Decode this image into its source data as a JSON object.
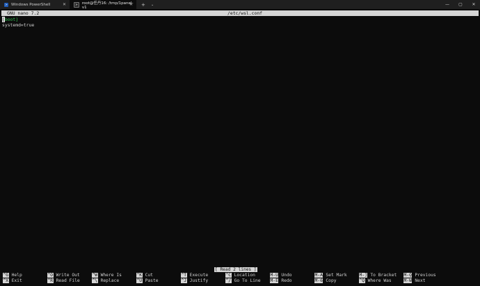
{
  "tabs": [
    {
      "label": "Windows PowerShell",
      "active": false
    },
    {
      "label": "root@任丹16: /tmp/1panel-v1",
      "active": true
    }
  ],
  "tab_actions": {
    "new_tab": "+",
    "dropdown": "⌄"
  },
  "window_controls": {
    "minimize": "—",
    "maximize": "▢",
    "close": "✕"
  },
  "nano": {
    "title_left": "GNU nano 7.2",
    "filename": "/etc/wsl.conf",
    "lines": [
      "[boot]",
      "systemd=true"
    ],
    "status": "[ Read 2 lines ]"
  },
  "shortcuts_row1": [
    {
      "key": "^G",
      "label": "Help"
    },
    {
      "key": "^O",
      "label": "Write Out"
    },
    {
      "key": "^W",
      "label": "Where Is"
    },
    {
      "key": "^K",
      "label": "Cut"
    },
    {
      "key": "^T",
      "label": "Execute"
    },
    {
      "key": "^C",
      "label": "Location"
    },
    {
      "key": "M-U",
      "label": "Undo"
    },
    {
      "key": "M-A",
      "label": "Set Mark"
    },
    {
      "key": "M-]",
      "label": "To Bracket"
    },
    {
      "key": "M-Q",
      "label": "Previous"
    }
  ],
  "shortcuts_row2": [
    {
      "key": "^X",
      "label": "Exit"
    },
    {
      "key": "^R",
      "label": "Read File"
    },
    {
      "key": "^\\",
      "label": "Replace"
    },
    {
      "key": "^U",
      "label": "Paste"
    },
    {
      "key": "^J",
      "label": "Justify"
    },
    {
      "key": "^/",
      "label": "Go To Line"
    },
    {
      "key": "M-E",
      "label": "Redo"
    },
    {
      "key": "M-6",
      "label": "Copy"
    },
    {
      "key": "^Q",
      "label": "Where Was"
    },
    {
      "key": "M-W",
      "label": "Next"
    }
  ],
  "colors": {
    "background": "#0c0c0c",
    "tabbar": "#1f1f1f",
    "inverse_bar": "#d6d6d6",
    "syntax_green": "#2fbf4d",
    "text": "#d0d0d0"
  }
}
